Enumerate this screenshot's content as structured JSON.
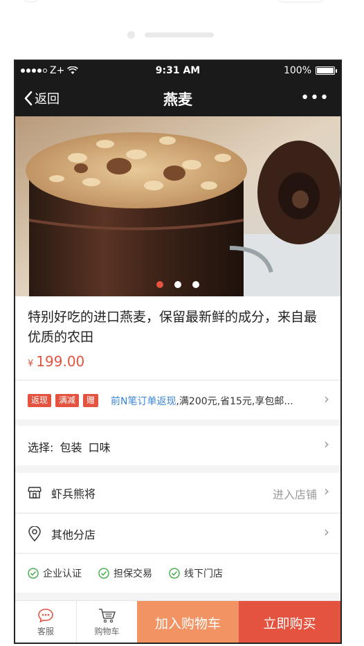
{
  "status_bar": {
    "carrier": "Z+",
    "time": "9:31 AM",
    "battery": "100%",
    "battery_level": 1.0
  },
  "nav": {
    "back_label": "返回",
    "title": "燕麦",
    "more_label": "•••"
  },
  "gallery": {
    "image_subject": "oats in a ceramic jar",
    "indicator_count": 3,
    "active_index": 0
  },
  "product": {
    "title": "特别好吃的进口燕麦，保留最新鲜的成分，来自最优质的农田",
    "currency_symbol": "¥",
    "price": "199.00"
  },
  "promo": {
    "tags": [
      "返现",
      "满减",
      "赠"
    ],
    "link_text": "前N笔订单返现",
    "rest_text": ",满200元,省15元,享包邮..."
  },
  "options": {
    "label": "选择: 包装 口味"
  },
  "store": {
    "name": "虾兵熊将",
    "enter_label": "进入店铺"
  },
  "branch": {
    "label": "其他分店"
  },
  "guarantees": [
    "企业认证",
    "担保交易",
    "线下门店"
  ],
  "bottom_bar": {
    "service_label": "客服",
    "cart_label": "购物车",
    "add_to_cart": "加入购物车",
    "buy_now": "立即购买"
  },
  "colors": {
    "accent": "#e4533f",
    "cart_button": "#f29364",
    "link": "#3b84d6",
    "check": "#4caf50",
    "nav_bg": "#1a1a1a"
  }
}
